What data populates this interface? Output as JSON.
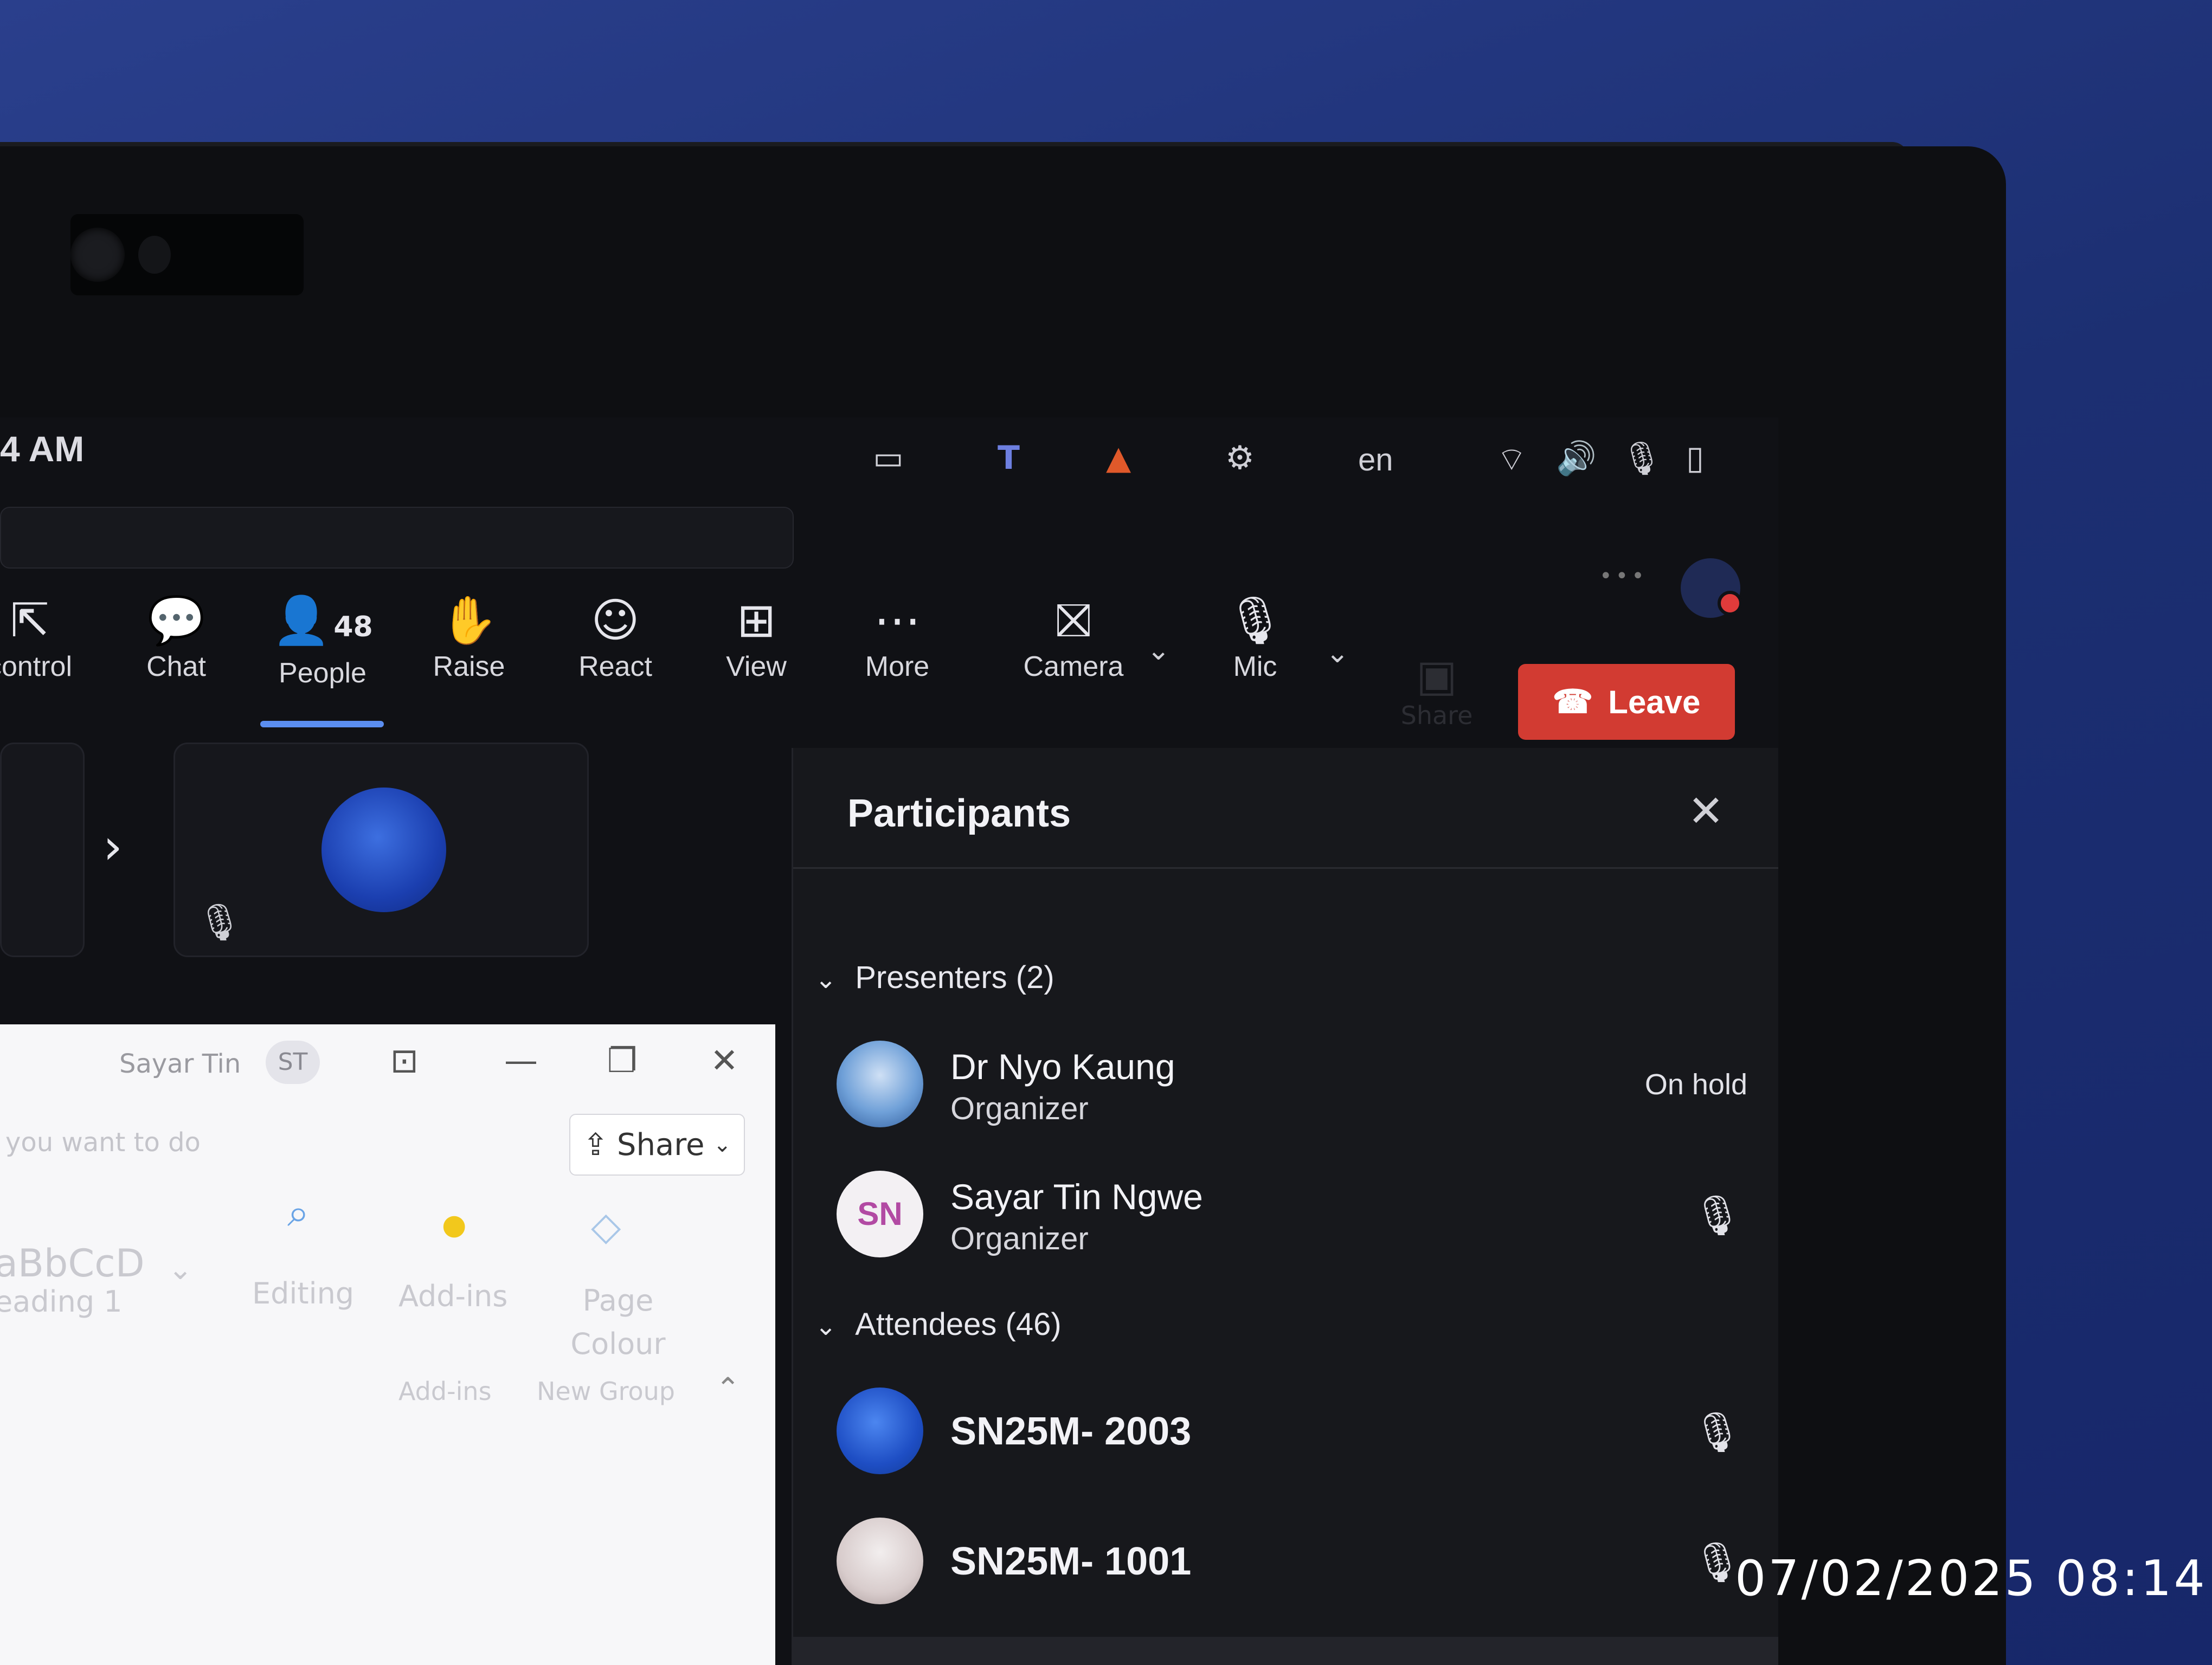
{
  "taskbar": {
    "clock": "4 AM",
    "language": "en",
    "tray_icons": [
      "display-icon",
      "teams-icon",
      "vlc-icon",
      "gear-icon",
      "wifi-icon",
      "volume-icon",
      "mic-off-icon",
      "battery-icon"
    ]
  },
  "toolbar": {
    "items": [
      {
        "label": "control",
        "icon": "screen-control-icon"
      },
      {
        "label": "Chat",
        "icon": "chat-icon"
      },
      {
        "label": "People",
        "icon": "people-icon",
        "count": "48"
      },
      {
        "label": "Raise",
        "icon": "hand-icon"
      },
      {
        "label": "React",
        "icon": "smile-icon"
      },
      {
        "label": "View",
        "icon": "grid-icon"
      },
      {
        "label": "More",
        "icon": "more-icon"
      },
      {
        "label": "Camera",
        "icon": "camera-off-icon"
      },
      {
        "label": "Mic",
        "icon": "mic-off-icon"
      }
    ],
    "share_label": "Share",
    "leave_label": "Leave",
    "active_color": "#5b8ef0",
    "leave_color": "#d23b32"
  },
  "word_window": {
    "user_name": "Sayar Tin",
    "user_initials": "ST",
    "hint_text": "you want to do",
    "share_label": "Share",
    "ribbon": {
      "styles_label": "aBbCcD",
      "heading_label": "eading 1",
      "editing_label": "Editing",
      "addins_label": "Add-ins",
      "page_color_label": "Page Colour",
      "addins_group": "Add-ins",
      "new_group": "New Group"
    }
  },
  "participants": {
    "title": "Participants",
    "presenters_header": "Presenters (2)",
    "attendees_header": "Attendees (46)",
    "presenters": [
      {
        "name": "Dr Nyo Kaung",
        "role": "Organizer",
        "status": "On hold",
        "avatar": "photo"
      },
      {
        "name": "Sayar Tin Ngwe",
        "role": "Organizer",
        "initials": "SN",
        "mic": "mic-icon"
      }
    ],
    "attendees": [
      {
        "name": "SN25M- 2003",
        "mic": "mic-off-icon"
      },
      {
        "name": "SN25M- 1001",
        "mic": "mic-off-icon"
      }
    ]
  },
  "photo_timestamp": "07/02/2025 08:14"
}
